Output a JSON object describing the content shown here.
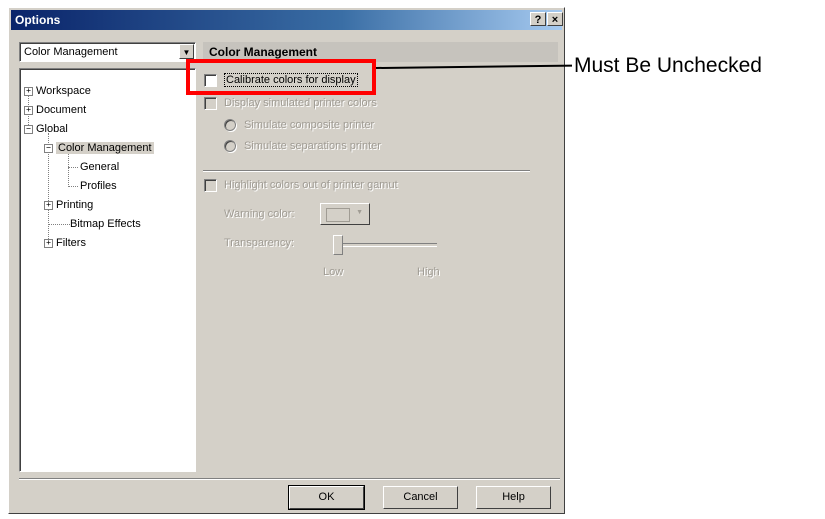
{
  "window": {
    "title": "Options",
    "help_button": "?",
    "close_button": "×"
  },
  "category_combo": {
    "selected": "Color Management"
  },
  "tree": {
    "items": [
      {
        "label": "Workspace",
        "expander": "+"
      },
      {
        "label": "Document",
        "expander": "+"
      },
      {
        "label": "Global",
        "expander": "−"
      },
      {
        "label": "Color Management",
        "expander": "−"
      },
      {
        "label": "General"
      },
      {
        "label": "Profiles"
      },
      {
        "label": "Printing",
        "expander": "+"
      },
      {
        "label": "Bitmap Effects"
      },
      {
        "label": "Filters",
        "expander": "+"
      }
    ]
  },
  "panel": {
    "header": "Color Management",
    "calibrate": {
      "label": "Calibrate colors for display",
      "checked": false
    },
    "simulated": {
      "label": "Display simulated printer colors",
      "enabled": false
    },
    "composite": {
      "label": "Simulate composite printer"
    },
    "separations": {
      "label": "Simulate separations printer"
    },
    "gamut": {
      "label": "Highlight colors out of printer gamut"
    },
    "warning_color": {
      "label": "Warning color:"
    },
    "transparency": {
      "label": "Transparency:",
      "low": "Low",
      "high": "High",
      "value": 0
    }
  },
  "buttons": {
    "ok": "OK",
    "cancel": "Cancel",
    "help": "Help"
  },
  "annotation": {
    "text": "Must Be Unchecked",
    "highlight_color": "#ff0000"
  },
  "colors": {
    "titlebar": "#0a246a",
    "dialog_bg": "#d4d0c8"
  }
}
